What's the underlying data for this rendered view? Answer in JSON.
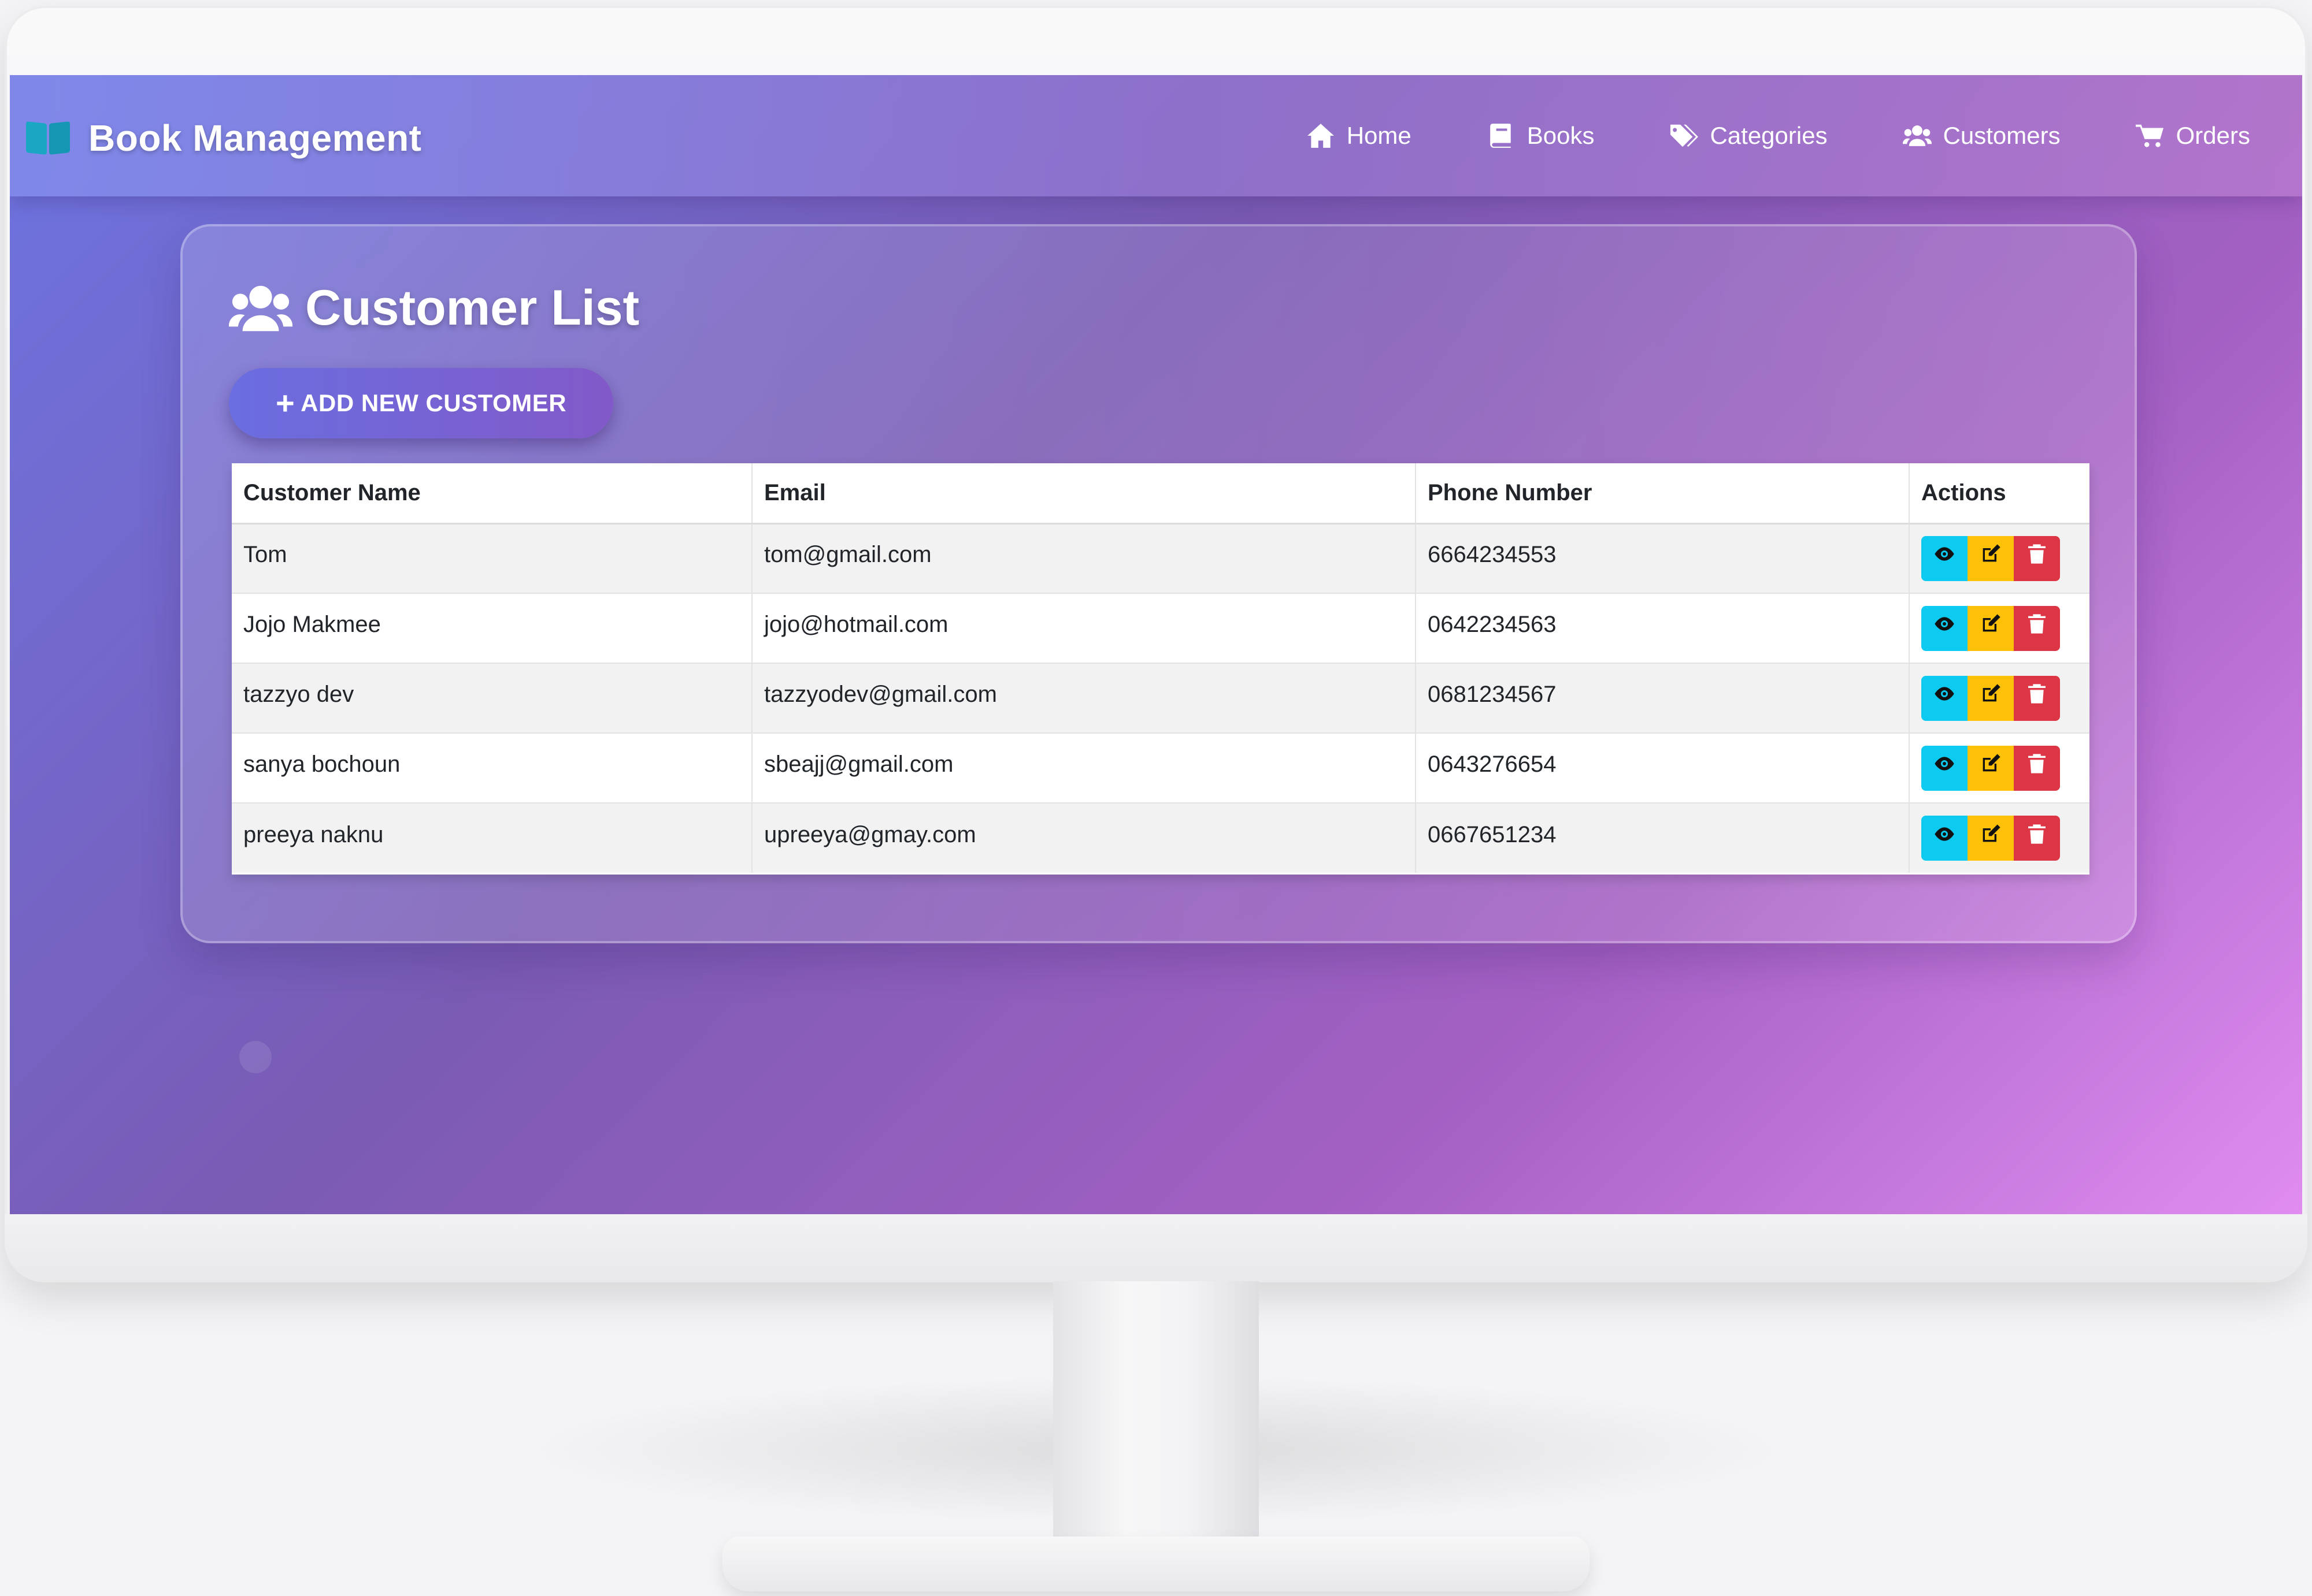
{
  "app": {
    "brand": "Book Management"
  },
  "nav": {
    "items": [
      {
        "label": "Home",
        "icon": "home-icon"
      },
      {
        "label": "Books",
        "icon": "book-icon"
      },
      {
        "label": "Categories",
        "icon": "tags-icon"
      },
      {
        "label": "Customers",
        "icon": "users-icon"
      },
      {
        "label": "Orders",
        "icon": "cart-icon"
      }
    ]
  },
  "page": {
    "title": "Customer List",
    "add_button_label": "ADD NEW CUSTOMER"
  },
  "table": {
    "headers": [
      "Customer Name",
      "Email",
      "Phone Number",
      "Actions"
    ],
    "rows": [
      {
        "name": "Tom",
        "email": "tom@gmail.com",
        "phone": "6664234553"
      },
      {
        "name": "Jojo Makmee",
        "email": "jojo@hotmail.com",
        "phone": "0642234563"
      },
      {
        "name": "tazzyo dev",
        "email": "tazzyodev@gmail.com",
        "phone": "0681234567"
      },
      {
        "name": "sanya bochoun",
        "email": "sbeajj@gmail.com",
        "phone": "0643276654"
      },
      {
        "name": "preeya naknu",
        "email": "upreeya@gmay.com",
        "phone": "0667651234"
      }
    ]
  },
  "colors": {
    "view": "#0dcaf0",
    "edit": "#ffc107",
    "delete": "#dc3545",
    "accent": "#6a6ee0"
  }
}
